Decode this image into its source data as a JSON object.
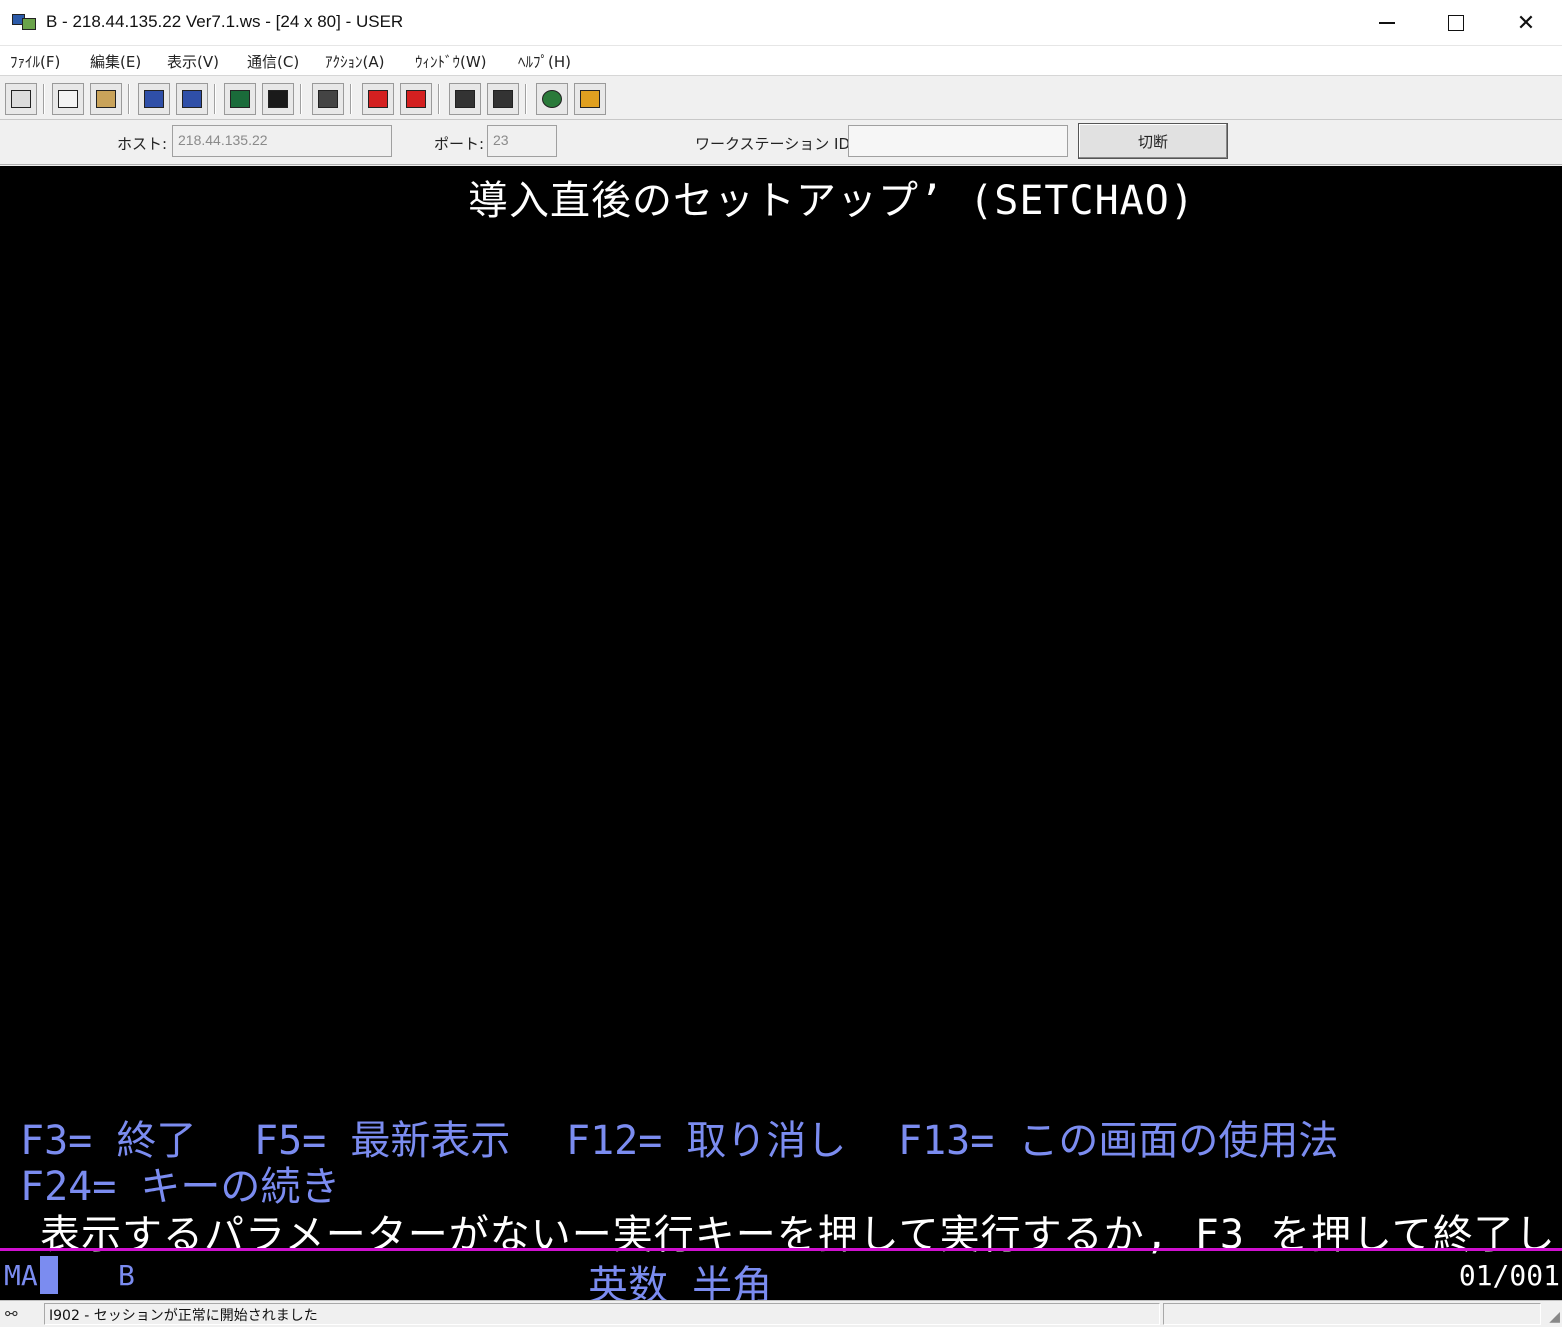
{
  "window": {
    "title": "B - 218.44.135.22 Ver7.1.ws - [24 x 80] - USER",
    "close_glyph": "✕"
  },
  "menu": [
    "ﾌｧｲﾙ(F)",
    "編集(E)",
    "表示(V)",
    "通信(C)",
    "ｱｸｼｮﾝ(A)",
    "ｳｨﾝﾄﾞｳ(W)",
    "ﾍﾙﾌﾟ(H)"
  ],
  "toolbar": {
    "icons": [
      "print-screen-icon",
      "copy-icon",
      "paste-icon",
      "send-file-icon",
      "receive-file-icon",
      "display-setup-icon",
      "keyboard-map-icon",
      "macro-icon",
      "record-macro-icon",
      "stop-macro-icon",
      "play-macro-icon",
      "run-macro-icon",
      "connect-icon",
      "help-icon"
    ]
  },
  "hostbar": {
    "host_label": "ホスト:",
    "host_value": "218.44.135.22",
    "port_label": "ポート:",
    "port_value": "23",
    "ws_label": "ワークステーション ID:",
    "ws_value": "",
    "disconnect_label": "切断"
  },
  "terminal": {
    "title": "導入直後のセットアップ’ (SETCHAO)",
    "fkeys_row1": [
      "F3= 終了",
      "F5= 最新表示",
      "F12= 取り消し",
      "F13= この画面の使用法"
    ],
    "fkeys_row2": [
      "F24= キーの続き"
    ],
    "message": "表示するパラメーターがないー実行キーを押して実行するか, F3 を押して終了し",
    "oia": {
      "ma": "MA",
      "session": "B",
      "input_mode": "英数 半角",
      "cursor_pos": "01/001"
    },
    "colors": {
      "background": "#000000",
      "text_white": "#ffffff",
      "text_blue": "#7b8cf0",
      "oia_line": "#d010d0"
    }
  },
  "status": {
    "message": "I902 - セッションが正常に開始されました"
  }
}
